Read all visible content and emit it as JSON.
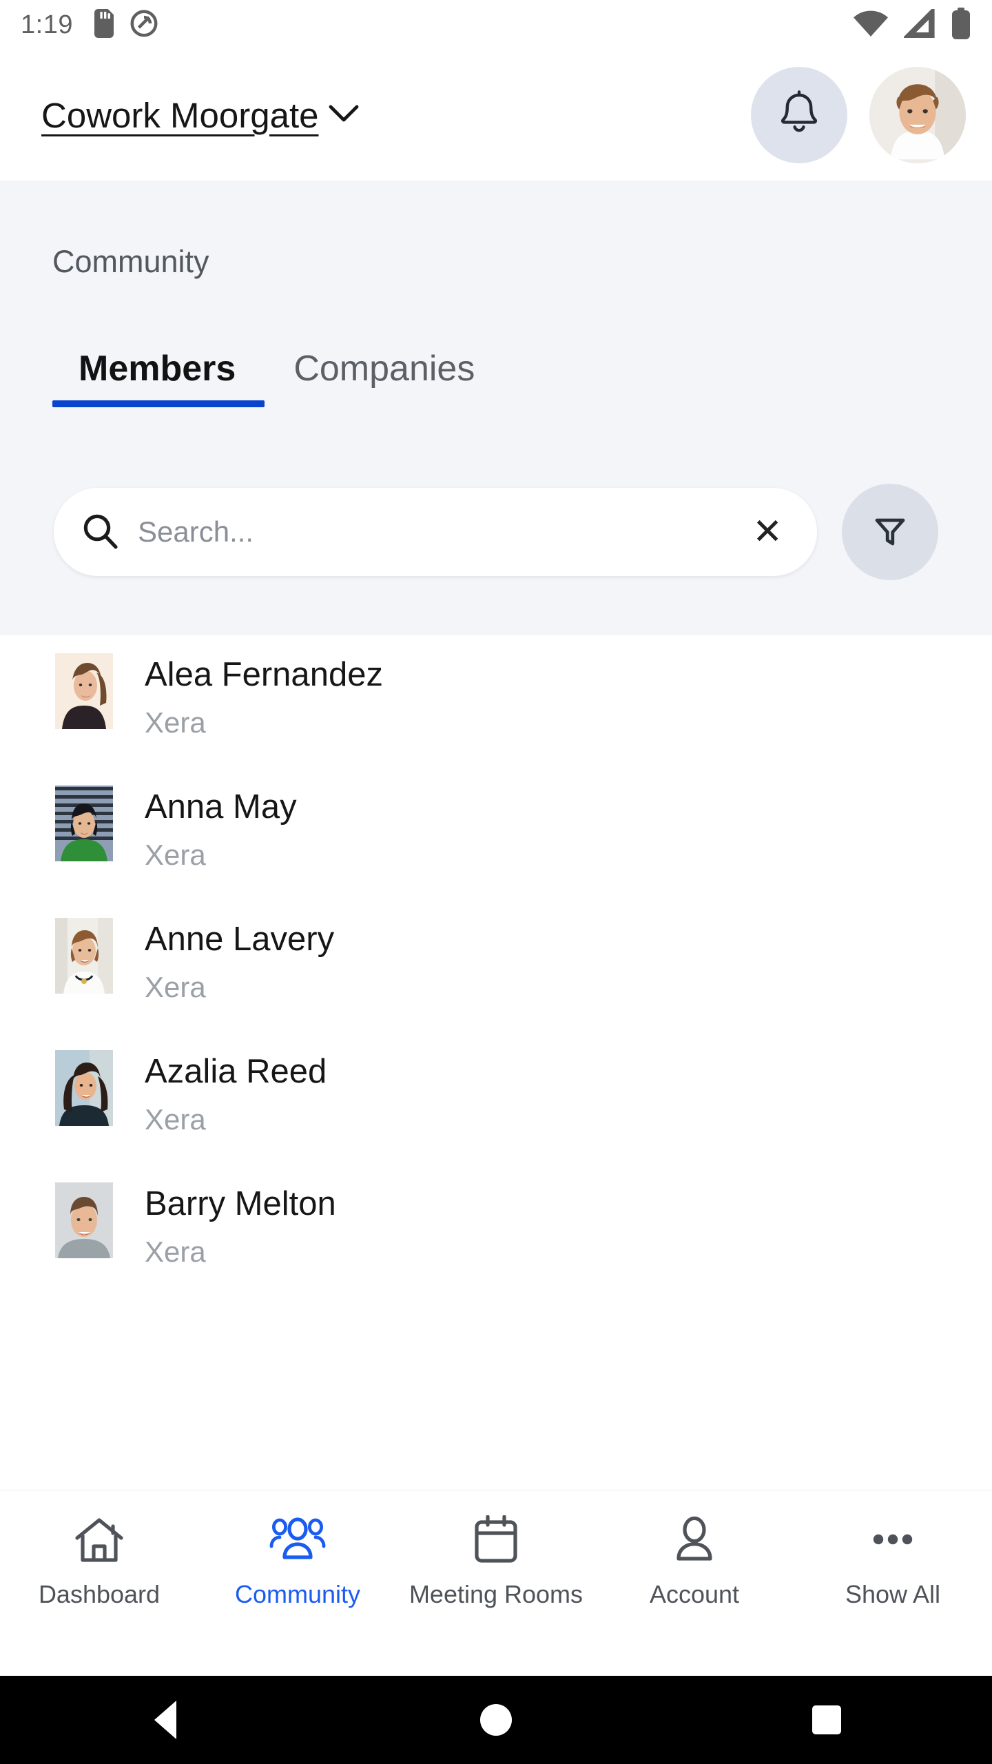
{
  "statusbar": {
    "time": "1:19",
    "left_icons": [
      "sdcard-icon",
      "sync-disabled-icon"
    ],
    "right_icons": [
      "wifi-icon",
      "cell-signal-icon",
      "battery-icon"
    ]
  },
  "appbar": {
    "venue_name": "Cowork Moorgate",
    "venue_chevron": "chevron-down-icon",
    "notifications_icon": "bell-icon",
    "avatar": "user-avatar"
  },
  "page": {
    "title": "Community"
  },
  "tabs": [
    {
      "label": "Members",
      "active": true
    },
    {
      "label": "Companies",
      "active": false
    }
  ],
  "search": {
    "placeholder": "Search...",
    "value": "",
    "search_icon": "search-icon",
    "clear_label": "✕",
    "filter_icon": "filter-icon"
  },
  "members": [
    {
      "name": "Alea Fernandez",
      "company": "Xera"
    },
    {
      "name": "Anna May",
      "company": "Xera"
    },
    {
      "name": "Anne Lavery",
      "company": "Xera"
    },
    {
      "name": "Azalia Reed",
      "company": "Xera"
    },
    {
      "name": "Barry Melton",
      "company": "Xera"
    }
  ],
  "bottom_nav": [
    {
      "label": "Dashboard",
      "icon": "home-icon",
      "active": false
    },
    {
      "label": "Community",
      "icon": "people-icon",
      "active": true
    },
    {
      "label": "Meeting Rooms",
      "icon": "calendar-icon",
      "active": false
    },
    {
      "label": "Account",
      "icon": "person-icon",
      "active": false
    },
    {
      "label": "Show All",
      "icon": "ellipsis-icon",
      "active": false
    }
  ],
  "android_nav": {
    "back": "back-triangle-icon",
    "home": "home-circle-icon",
    "recents": "recents-square-icon"
  },
  "colors": {
    "accent": "#1a5cf0",
    "tab_underline": "#0b44cc",
    "section_bg": "#f4f5f9",
    "chip_bg": "#dbe0e8",
    "muted_text": "#9aa0a6"
  }
}
